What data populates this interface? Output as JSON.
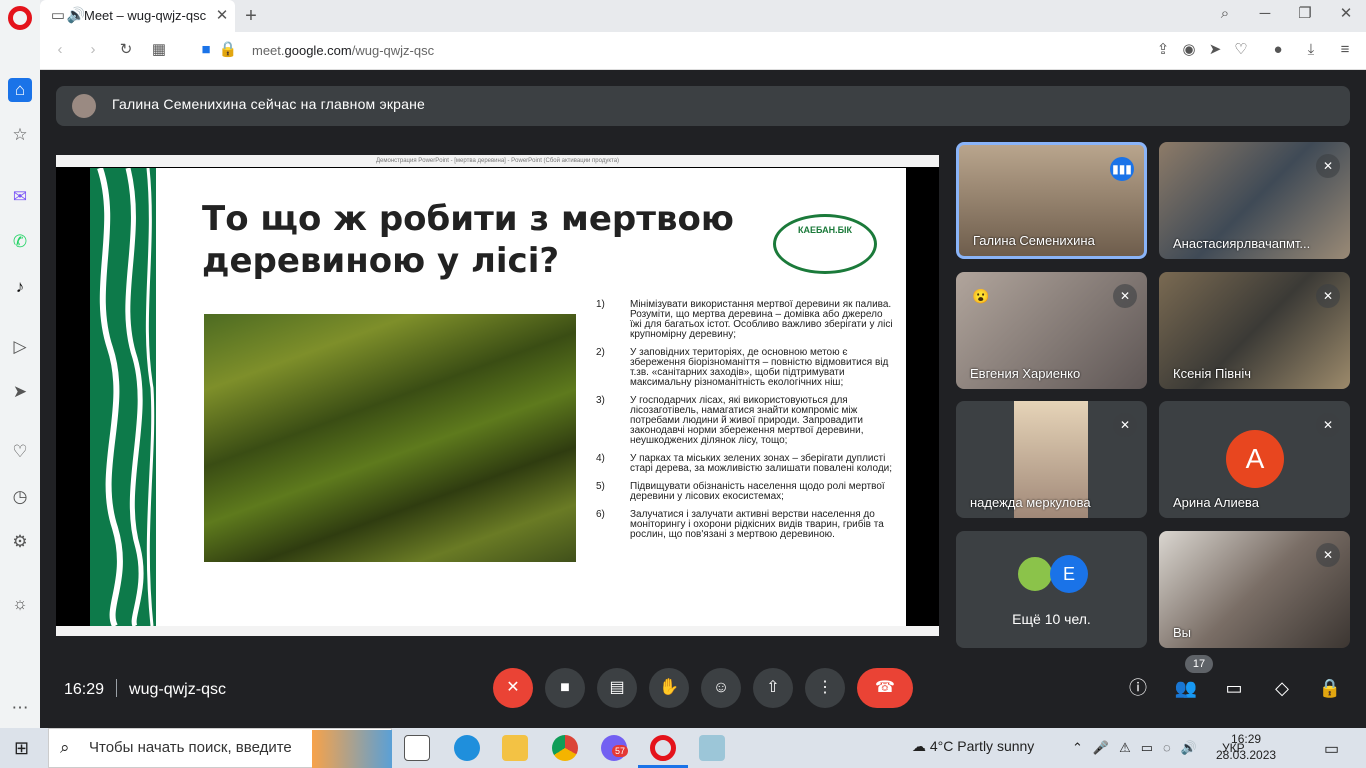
{
  "browser": {
    "tab_title": "Meet – wug-qwjz-qsc",
    "url_prefix": "meet.",
    "url_domain": "google.com",
    "url_path": "/wug-qwjz-qsc"
  },
  "meet": {
    "banner_text": "Галина Семенихина сейчас на главном экране",
    "time": "16:29",
    "meeting_code": "wug-qwjz-qsc",
    "people_count": "17"
  },
  "slide": {
    "window_title": "Демонстрация PowerPoint - [мертва деревина] - PowerPoint (Сбой активации продукта)",
    "title": "То що ж робити з мертвою деревиною у лісі?",
    "logo_text": "КАЕБАН.БІК",
    "items": [
      {
        "num": "1)",
        "text": "Мінімізувати використання мертвої деревини як палива. Розуміти, що мертва деревина – домівка або джерело їжі для багатьох істот. Особливо важливо зберігати у лісі крупномірну деревину;"
      },
      {
        "num": "2)",
        "text": "У заповідних територіях, де основною метою є збереження біорізноманіття – повністю відмовитися від т.зв. «санітарних заходів», щоби підтримувати максимальну різноманітність екологічних ніш;"
      },
      {
        "num": "3)",
        "text": "У господарчих лісах, які використовуються для лісозаготівель, намагатися знайти компроміс між потребами людини й живої природи. Запровадити законодавчі норми збереження мертвої деревини, неушкоджених ділянок лісу, тощо;"
      },
      {
        "num": "4)",
        "text": "У парках та міських зелених зонах – зберігати дуплисті старі дерева, за можливістю залишати повалені колоди;"
      },
      {
        "num": "5)",
        "text": "Підвищувати обізнаність населення щодо ролі мертвої деревини у лісових екосистемах;"
      },
      {
        "num": "6)",
        "text": "Залучатися і залучати активні верстви населення до моніторингу і охорони рідкісних видів тварин, грибів та рослин, що пов'язані з мертвою деревиною."
      }
    ]
  },
  "participants": [
    {
      "name": "Галина Семенихина",
      "state": "speaking"
    },
    {
      "name": "Анастасияpлвачапмт...",
      "state": "muted"
    },
    {
      "name": "Евгения Хариенко",
      "state": "muted",
      "reaction": "😮"
    },
    {
      "name": "Ксенія Північ",
      "state": "muted"
    },
    {
      "name": "надежда меркулова",
      "state": "muted"
    },
    {
      "name": "Арина Алиева",
      "state": "muted",
      "initial": "А"
    },
    {
      "name": "Вы",
      "state": "muted"
    }
  ],
  "more_people": {
    "label": "Ещё 10 чел.",
    "avatar_initial": "Е"
  },
  "taskbar": {
    "search_placeholder": "Чтобы начать поиск, введите",
    "badge": "57",
    "weather": "4°C  Partly sunny",
    "lang": "УКР",
    "time": "16:29",
    "date": "28.03.2023"
  }
}
